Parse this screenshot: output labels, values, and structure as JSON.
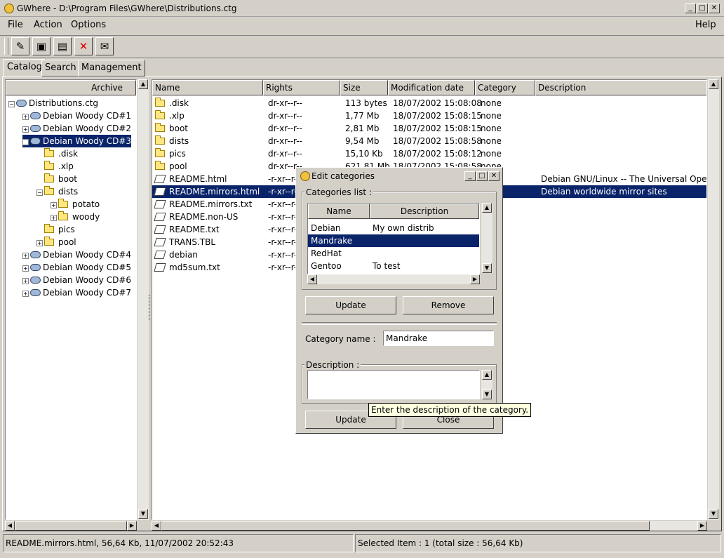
{
  "window": {
    "title": "GWhere - D:\\Program Files\\GWhere\\Distributions.ctg",
    "minimize": "_",
    "maximize": "□",
    "close": "✕"
  },
  "menu": {
    "file": "File",
    "action": "Action",
    "options": "Options",
    "help": "Help"
  },
  "tabs": {
    "catalog": "Catalog",
    "search": "Search",
    "management": "Management"
  },
  "tree": {
    "header": "Archive",
    "root": "Distributions.ctg",
    "items": [
      {
        "label": "Debian Woody CD#1"
      },
      {
        "label": "Debian Woody CD#2"
      },
      {
        "label": "Debian Woody CD#3"
      },
      {
        "label": ".disk"
      },
      {
        "label": ".xlp"
      },
      {
        "label": "boot"
      },
      {
        "label": "dists"
      },
      {
        "label": "potato"
      },
      {
        "label": "woody"
      },
      {
        "label": "pics"
      },
      {
        "label": "pool"
      },
      {
        "label": "Debian Woody CD#4"
      },
      {
        "label": "Debian Woody CD#5"
      },
      {
        "label": "Debian Woody CD#6"
      },
      {
        "label": "Debian Woody CD#7"
      }
    ]
  },
  "files": {
    "headers": {
      "name": "Name",
      "rights": "Rights",
      "size": "Size",
      "modified": "Modification date",
      "category": "Category",
      "description": "Description"
    },
    "rows": [
      {
        "name": ".disk",
        "rights": "dr-xr--r--",
        "size": "113 bytes",
        "modified": "18/07/2002 15:08:08",
        "category": "none",
        "description": ""
      },
      {
        "name": ".xlp",
        "rights": "dr-xr--r--",
        "size": "1,77 Mb",
        "modified": "18/07/2002 15:08:15",
        "category": "none",
        "description": ""
      },
      {
        "name": "boot",
        "rights": "dr-xr--r--",
        "size": "2,81 Mb",
        "modified": "18/07/2002 15:08:15",
        "category": "none",
        "description": ""
      },
      {
        "name": "dists",
        "rights": "dr-xr--r--",
        "size": "9,54 Mb",
        "modified": "18/07/2002 15:08:58",
        "category": "none",
        "description": ""
      },
      {
        "name": "pics",
        "rights": "dr-xr--r--",
        "size": "15,10 Kb",
        "modified": "18/07/2002 15:08:12",
        "category": "none",
        "description": ""
      },
      {
        "name": "pool",
        "rights": "dr-xr--r--",
        "size": "621,81 Mb",
        "modified": "18/07/2002 15:08:58",
        "category": "none",
        "description": ""
      },
      {
        "name": "README.html",
        "rights": "-r-xr--r--",
        "size": "",
        "modified": "",
        "category": "",
        "description": "Debian GNU/Linux -- The Universal Opera"
      },
      {
        "name": "README.mirrors.html",
        "rights": "-r-xr--r--",
        "size": "",
        "modified": "",
        "category": "",
        "description": "Debian worldwide mirror sites"
      },
      {
        "name": "README.mirrors.txt",
        "rights": "-r-xr--r--",
        "size": "",
        "modified": "",
        "category": "",
        "description": ""
      },
      {
        "name": "README.non-US",
        "rights": "-r-xr--r--",
        "size": "",
        "modified": "",
        "category": "",
        "description": ""
      },
      {
        "name": "README.txt",
        "rights": "-r-xr--r--",
        "size": "",
        "modified": "",
        "category": "",
        "description": ""
      },
      {
        "name": "TRANS.TBL",
        "rights": "-r-xr--r--",
        "size": "",
        "modified": "",
        "category": "",
        "description": ""
      },
      {
        "name": "debian",
        "rights": "-r-xr--r--",
        "size": "",
        "modified": "",
        "category": "",
        "description": ""
      },
      {
        "name": "md5sum.txt",
        "rights": "-r-xr--r--",
        "size": "",
        "modified": "",
        "category": "",
        "description": ""
      }
    ]
  },
  "dialog": {
    "title": "Edit categories",
    "list_group": "Categories list :",
    "col_name": "Name",
    "col_description": "Description",
    "rows": [
      {
        "name": "Debian",
        "description": "My own distrib"
      },
      {
        "name": "Mandrake",
        "description": ""
      },
      {
        "name": "RedHat",
        "description": ""
      },
      {
        "name": "Gentoo",
        "description": "To test"
      }
    ],
    "update": "Update",
    "remove": "Remove",
    "category_name_label": "Category name :",
    "category_name_value": "Mandrake",
    "description_group": "Description :",
    "description_value": "",
    "update2": "Update",
    "close": "Close",
    "tooltip": "Enter the description of the category."
  },
  "status": {
    "left": "README.mirrors.html, 56,64 Kb, 11/07/2002 20:52:43",
    "right": "Selected Item : 1 (total size : 56,64 Kb)"
  }
}
